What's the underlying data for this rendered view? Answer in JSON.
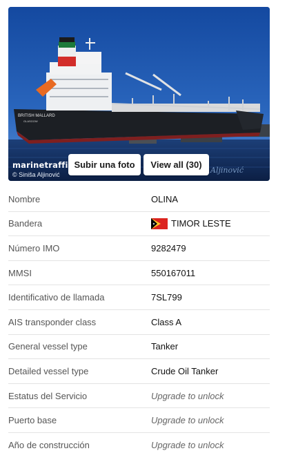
{
  "photo": {
    "brand": "marinetraffic",
    "credit": "© Siniša Aljinović",
    "watermark": "Aljinović",
    "upload_label": "Subir una foto",
    "view_all_label": "View all (30)",
    "hull_name": "BRITISH MALLARD",
    "hull_port": "GLASGOW"
  },
  "colors": {
    "sky": "#1b55a6",
    "hull": "#1c1f24",
    "funnel_red": "#d22d2a",
    "funnel_green": "#1d7a3a"
  },
  "flag_icon": "timor-leste-flag",
  "rows": [
    {
      "label": "Nombre",
      "value": "OLINA",
      "locked": false
    },
    {
      "label": "Bandera",
      "value": "TIMOR LESTE",
      "locked": false,
      "flag": true
    },
    {
      "label": "Número IMO",
      "value": "9282479",
      "locked": false
    },
    {
      "label": "MMSI",
      "value": "550167011",
      "locked": false
    },
    {
      "label": "Identificativo de llamada",
      "value": "7SL799",
      "locked": false
    },
    {
      "label": "AIS transponder class",
      "value": "Class A",
      "locked": false
    },
    {
      "label": "General vessel type",
      "value": "Tanker",
      "locked": false
    },
    {
      "label": "Detailed vessel type",
      "value": "Crude Oil Tanker",
      "locked": false
    },
    {
      "label": "Estatus del Servicio",
      "value": "Upgrade to unlock",
      "locked": true
    },
    {
      "label": "Puerto base",
      "value": "Upgrade to unlock",
      "locked": true
    },
    {
      "label": "Año de construcción",
      "value": "Upgrade to unlock",
      "locked": true
    }
  ]
}
